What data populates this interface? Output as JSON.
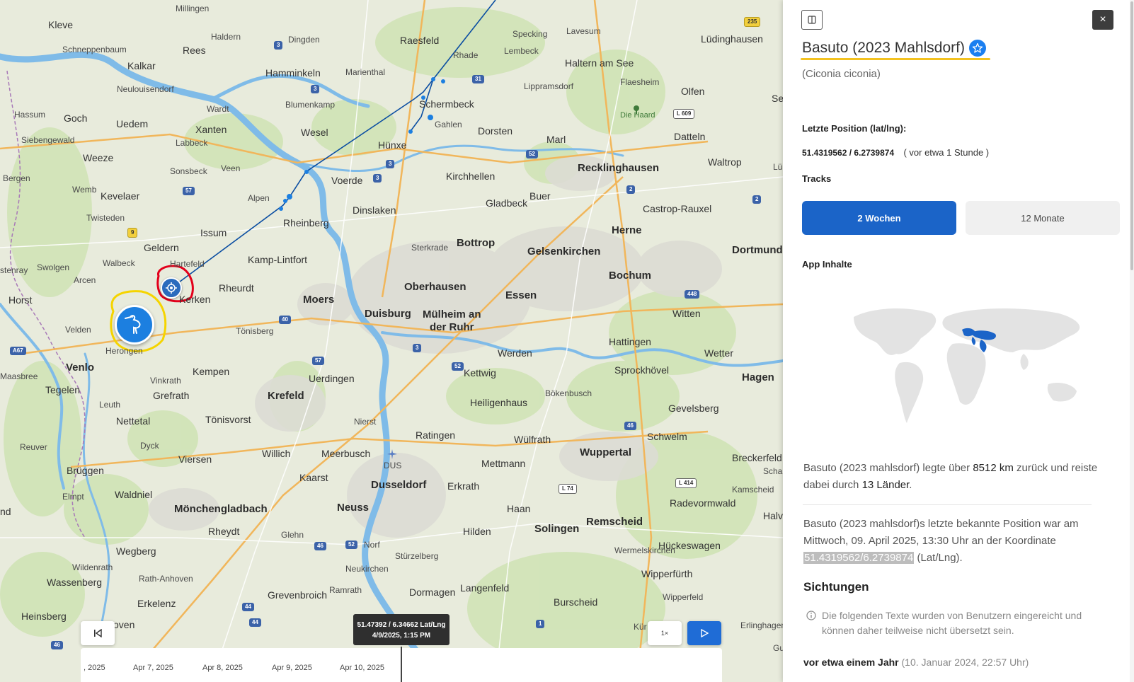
{
  "map": {
    "places": [
      {
        "id": "kleve",
        "label": "Kleve",
        "cls": "mid"
      },
      {
        "id": "millingen",
        "label": "Millingen",
        "cls": "small"
      },
      {
        "id": "schneppenbaum",
        "label": "Schneppenbaum",
        "cls": "small"
      },
      {
        "id": "haldern",
        "label": "Haldern",
        "cls": "small"
      },
      {
        "id": "rees",
        "label": "Rees",
        "cls": "mid"
      },
      {
        "id": "dingden",
        "label": "Dingden",
        "cls": "small"
      },
      {
        "id": "raesfeld",
        "label": "Raesfeld",
        "cls": "mid"
      },
      {
        "id": "specking",
        "label": "Specking",
        "cls": "small"
      },
      {
        "id": "lavesum",
        "label": "Lavesum",
        "cls": "small"
      },
      {
        "id": "luedinghausen",
        "label": "Lüdinghausen",
        "cls": "mid"
      },
      {
        "id": "kalkar",
        "label": "Kalkar",
        "cls": "mid"
      },
      {
        "id": "hamminkeln",
        "label": "Hamminkeln",
        "cls": "mid"
      },
      {
        "id": "marienthal",
        "label": "Marienthal",
        "cls": "small"
      },
      {
        "id": "rhade",
        "label": "Rhade",
        "cls": "small"
      },
      {
        "id": "lembeck",
        "label": "Lembeck",
        "cls": "small"
      },
      {
        "id": "halternamsee",
        "label": "Haltern am See",
        "cls": "mid"
      },
      {
        "id": "neulouisendorf",
        "label": "Neulouisendorf",
        "cls": "small"
      },
      {
        "id": "lippramsdorf",
        "label": "Lippramsdorf",
        "cls": "small"
      },
      {
        "id": "flaesheim",
        "label": "Flaesheim",
        "cls": "small"
      },
      {
        "id": "olfen",
        "label": "Olfen",
        "cls": "mid"
      },
      {
        "id": "hassum",
        "label": "Hassum",
        "cls": "small"
      },
      {
        "id": "goch",
        "label": "Goch",
        "cls": "mid"
      },
      {
        "id": "uedem",
        "label": "Uedem",
        "cls": "mid"
      },
      {
        "id": "blumenkamp",
        "label": "Blumenkamp",
        "cls": "small"
      },
      {
        "id": "schermbeck",
        "label": "Schermbeck",
        "cls": "mid"
      },
      {
        "id": "selm",
        "label": "Selm",
        "cls": "mid"
      },
      {
        "id": "wardt",
        "label": "Wardt",
        "cls": "small"
      },
      {
        "id": "dieharrd",
        "label": "Die Haard",
        "cls": "green"
      },
      {
        "id": "siebengewald",
        "label": "Siebengewald",
        "cls": "small"
      },
      {
        "id": "xanten",
        "label": "Xanten",
        "cls": "mid"
      },
      {
        "id": "wesel",
        "label": "Wesel",
        "cls": "mid"
      },
      {
        "id": "gahlen",
        "label": "Gahlen",
        "cls": "small"
      },
      {
        "id": "dorsten",
        "label": "Dorsten",
        "cls": "mid"
      },
      {
        "id": "datteln",
        "label": "Datteln",
        "cls": "mid"
      },
      {
        "id": "labbeck",
        "label": "Labbeck",
        "cls": "small"
      },
      {
        "id": "huenxe",
        "label": "Hünxe",
        "cls": "mid"
      },
      {
        "id": "marl",
        "label": "Marl",
        "cls": "mid"
      },
      {
        "id": "waltrop",
        "label": "Waltrop",
        "cls": "mid"
      },
      {
        "id": "weeze",
        "label": "Weeze",
        "cls": "mid"
      },
      {
        "id": "veen",
        "label": "Veen",
        "cls": "small"
      },
      {
        "id": "sonsbeck",
        "label": "Sonsbeck",
        "cls": "small"
      },
      {
        "id": "recklinghausen",
        "label": "Recklinghausen",
        "cls": "big"
      },
      {
        "id": "bergen",
        "label": "Bergen",
        "cls": "small"
      },
      {
        "id": "kirchhellen",
        "label": "Kirchhellen",
        "cls": "mid"
      },
      {
        "id": "voerde",
        "label": "Voerde",
        "cls": "mid"
      },
      {
        "id": "wemb",
        "label": "Wemb",
        "cls": "small"
      },
      {
        "id": "kevelaer",
        "label": "Kevelaer",
        "cls": "mid"
      },
      {
        "id": "alpen",
        "label": "Alpen",
        "cls": "small"
      },
      {
        "id": "buer",
        "label": "Buer",
        "cls": "mid"
      },
      {
        "id": "gladbeck",
        "label": "Gladbeck",
        "cls": "mid"
      },
      {
        "id": "castroprauxel",
        "label": "Castrop-Rauxel",
        "cls": "mid"
      },
      {
        "id": "dinslaken",
        "label": "Dinslaken",
        "cls": "mid"
      },
      {
        "id": "twisteden",
        "label": "Twisteden",
        "cls": "small"
      },
      {
        "id": "rheinberg",
        "label": "Rheinberg",
        "cls": "mid"
      },
      {
        "id": "issum",
        "label": "Issum",
        "cls": "mid"
      },
      {
        "id": "herne",
        "label": "Herne",
        "cls": "big"
      },
      {
        "id": "dortmund",
        "label": "Dortmund",
        "cls": "big"
      },
      {
        "id": "bottrop",
        "label": "Bottrop",
        "cls": "big"
      },
      {
        "id": "sterkrade",
        "label": "Sterkrade",
        "cls": "small"
      },
      {
        "id": "geldern",
        "label": "Geldern",
        "cls": "mid"
      },
      {
        "id": "gelsenkirchen",
        "label": "Gelsenkirchen",
        "cls": "big"
      },
      {
        "id": "kamplintfort",
        "label": "Kamp-Lintfort",
        "cls": "mid"
      },
      {
        "id": "walbeck",
        "label": "Walbeck",
        "cls": "small"
      },
      {
        "id": "swolgen",
        "label": "Swolgen",
        "cls": "small"
      },
      {
        "id": "hartefeld",
        "label": "Hartefeld",
        "cls": "small"
      },
      {
        "id": "bochum",
        "label": "Bochum",
        "cls": "big"
      },
      {
        "id": "astenray",
        "label": "stenray",
        "cls": "small"
      },
      {
        "id": "arcen",
        "label": "Arcen",
        "cls": "small"
      },
      {
        "id": "rheurdt",
        "label": "Rheurdt",
        "cls": "mid"
      },
      {
        "id": "oberhausen",
        "label": "Oberhausen",
        "cls": "big"
      },
      {
        "id": "essen",
        "label": "Essen",
        "cls": "big"
      },
      {
        "id": "moers",
        "label": "Moers",
        "cls": "big"
      },
      {
        "id": "horst",
        "label": "Horst",
        "cls": "mid"
      },
      {
        "id": "kerken",
        "label": "Kerken",
        "cls": "mid"
      },
      {
        "id": "duisburg",
        "label": "Duisburg",
        "cls": "big"
      },
      {
        "id": "muelheim",
        "label": "Mülheim an\nder Ruhr",
        "cls": "big"
      },
      {
        "id": "witten",
        "label": "Witten",
        "cls": "mid"
      },
      {
        "id": "velden",
        "label": "Velden",
        "cls": "small"
      },
      {
        "id": "toenisberg",
        "label": "Tönisberg",
        "cls": "small"
      },
      {
        "id": "hattingen",
        "label": "Hattingen",
        "cls": "mid"
      },
      {
        "id": "herongen",
        "label": "Herongen",
        "cls": "small"
      },
      {
        "id": "wetter",
        "label": "Wetter",
        "cls": "mid"
      },
      {
        "id": "werden",
        "label": "Werden",
        "cls": "mid"
      },
      {
        "id": "venlo",
        "label": "Venlo",
        "cls": "big"
      },
      {
        "id": "vinkrath",
        "label": "Vinkrath",
        "cls": "small"
      },
      {
        "id": "kempen",
        "label": "Kempen",
        "cls": "mid"
      },
      {
        "id": "sprockhoevel",
        "label": "Sprockhövel",
        "cls": "mid"
      },
      {
        "id": "maasbree",
        "label": "Maasbree",
        "cls": "small"
      },
      {
        "id": "kettwig",
        "label": "Kettwig",
        "cls": "mid"
      },
      {
        "id": "uerdingen",
        "label": "Uerdingen",
        "cls": "mid"
      },
      {
        "id": "hagen",
        "label": "Hagen",
        "cls": "big"
      },
      {
        "id": "tegelen",
        "label": "Tegelen",
        "cls": "mid"
      },
      {
        "id": "boekenbusch",
        "label": "Bökenbusch",
        "cls": "small"
      },
      {
        "id": "leuth",
        "label": "Leuth",
        "cls": "small"
      },
      {
        "id": "grefrath",
        "label": "Grefrath",
        "cls": "mid"
      },
      {
        "id": "krefeld",
        "label": "Krefeld",
        "cls": "big"
      },
      {
        "id": "heiligenhaus",
        "label": "Heiligenhaus",
        "cls": "mid"
      },
      {
        "id": "gevelsberg",
        "label": "Gevelsberg",
        "cls": "mid"
      },
      {
        "id": "nettetal",
        "label": "Nettetal",
        "cls": "mid"
      },
      {
        "id": "toenisvorst",
        "label": "Tönisvorst",
        "cls": "mid"
      },
      {
        "id": "nierst",
        "label": "Nierst",
        "cls": "small"
      },
      {
        "id": "ratingen",
        "label": "Ratingen",
        "cls": "mid"
      },
      {
        "id": "reuver",
        "label": "Reuver",
        "cls": "small"
      },
      {
        "id": "dyck",
        "label": "Dyck",
        "cls": "small"
      },
      {
        "id": "wuelfrath",
        "label": "Wülfrath",
        "cls": "mid"
      },
      {
        "id": "schwelm",
        "label": "Schwelm",
        "cls": "mid"
      },
      {
        "id": "willich",
        "label": "Willich",
        "cls": "mid"
      },
      {
        "id": "meerbusch",
        "label": "Meerbusch",
        "cls": "mid"
      },
      {
        "id": "wuppertal",
        "label": "Wuppertal",
        "cls": "big"
      },
      {
        "id": "breckerfeld",
        "label": "Breckerfeld",
        "cls": "mid"
      },
      {
        "id": "viersen",
        "label": "Viersen",
        "cls": "mid"
      },
      {
        "id": "mettmann",
        "label": "Mettmann",
        "cls": "mid"
      },
      {
        "id": "schal",
        "label": "Schal",
        "cls": "small"
      },
      {
        "id": "brueggen",
        "label": "Brüggen",
        "cls": "mid"
      },
      {
        "id": "kaarst",
        "label": "Kaarst",
        "cls": "mid"
      },
      {
        "id": "duesseldorf",
        "label": "Dusseldorf",
        "cls": "big"
      },
      {
        "id": "erkrath",
        "label": "Erkrath",
        "cls": "mid"
      },
      {
        "id": "kamsche",
        "label": "Kamscheid",
        "cls": "small"
      },
      {
        "id": "waldniel",
        "label": "Waldniel",
        "cls": "mid"
      },
      {
        "id": "elmpt",
        "label": "Elmpt",
        "cls": "small"
      },
      {
        "id": "radevormwald",
        "label": "Radevormwald",
        "cls": "mid"
      },
      {
        "id": "neuss",
        "label": "Neuss",
        "cls": "big"
      },
      {
        "id": "haan",
        "label": "Haan",
        "cls": "mid"
      },
      {
        "id": "moenchengladbach",
        "label": "Mönchengladbach",
        "cls": "big"
      },
      {
        "id": "solingen",
        "label": "Solingen",
        "cls": "big"
      },
      {
        "id": "halver",
        "label": "Halver",
        "cls": "mid"
      },
      {
        "id": "remscheid",
        "label": "Remscheid",
        "cls": "big"
      },
      {
        "id": "hilden",
        "label": "Hilden",
        "cls": "mid"
      },
      {
        "id": "rheydt",
        "label": "Rheydt",
        "cls": "mid"
      },
      {
        "id": "glehn",
        "label": "Glehn",
        "cls": "small"
      },
      {
        "id": "wegberg",
        "label": "Wegberg",
        "cls": "mid"
      },
      {
        "id": "norf",
        "label": "Norf",
        "cls": "small"
      },
      {
        "id": "hueckeswagen",
        "label": "Hückeswagen",
        "cls": "mid"
      },
      {
        "id": "stuerzelberg",
        "label": "Stürzelberg",
        "cls": "small"
      },
      {
        "id": "wildenrath",
        "label": "Wildenrath",
        "cls": "small"
      },
      {
        "id": "wermelskirchen",
        "label": "Wermelskirchen",
        "cls": "small"
      },
      {
        "id": "wipperfuerth",
        "label": "Wipperfürth",
        "cls": "mid"
      },
      {
        "id": "wassenberg",
        "label": "Wassenberg",
        "cls": "mid"
      },
      {
        "id": "rathkeloelen",
        "label": "Rath-Anhoven",
        "cls": "small"
      },
      {
        "id": "langenfeld",
        "label": "Langenfeld",
        "cls": "mid"
      },
      {
        "id": "wipperfeld",
        "label": "Wipperfeld",
        "cls": "small"
      },
      {
        "id": "neukirchen",
        "label": "Neukirchen",
        "cls": "small"
      },
      {
        "id": "ramrath",
        "label": "Ramrath",
        "cls": "small"
      },
      {
        "id": "grevenbroich",
        "label": "Grevenbroich",
        "cls": "mid"
      },
      {
        "id": "dormagen",
        "label": "Dormagen",
        "cls": "mid"
      },
      {
        "id": "erkelenz",
        "label": "Erkelenz",
        "cls": "mid"
      },
      {
        "id": "burscheid",
        "label": "Burscheid",
        "cls": "mid"
      },
      {
        "id": "heinsberg",
        "label": "Heinsberg",
        "cls": "mid"
      },
      {
        "id": "hoven",
        "label": "oven",
        "cls": "mid"
      },
      {
        "id": "erlinghagen",
        "label": "Erlinghagen",
        "cls": "small"
      },
      {
        "id": "kuer",
        "label": "Kür",
        "cls": "small"
      },
      {
        "id": "gu",
        "label": "Gu",
        "cls": "small"
      },
      {
        "id": "lue",
        "label": "Lü",
        "cls": "small"
      },
      {
        "id": "nd",
        "label": "nd",
        "cls": "mid"
      },
      {
        "id": "dus",
        "label": "DUS",
        "cls": "small"
      }
    ],
    "shields": [
      {
        "id": "s235",
        "label": "235",
        "cls": "yellow"
      },
      {
        "id": "s3a",
        "label": "3",
        "cls": "blue"
      },
      {
        "id": "s3b",
        "label": "3",
        "cls": "blue"
      },
      {
        "id": "s31",
        "label": "31",
        "cls": "blue"
      },
      {
        "id": "sL609",
        "label": "L 609",
        "cls": "white"
      },
      {
        "id": "s52a",
        "label": "52",
        "cls": "blue"
      },
      {
        "id": "s3c",
        "label": "3",
        "cls": "blue"
      },
      {
        "id": "s3d",
        "label": "3",
        "cls": "blue"
      },
      {
        "id": "s2a",
        "label": "2",
        "cls": "blue"
      },
      {
        "id": "s2b",
        "label": "2",
        "cls": "blue"
      },
      {
        "id": "s57a",
        "label": "57",
        "cls": "blue"
      },
      {
        "id": "s9",
        "label": "9",
        "cls": "yellow"
      },
      {
        "id": "s448",
        "label": "448",
        "cls": "blue"
      },
      {
        "id": "s40",
        "label": "40",
        "cls": "blue"
      },
      {
        "id": "sA67",
        "label": "A67",
        "cls": "blue"
      },
      {
        "id": "s57b",
        "label": "57",
        "cls": "blue"
      },
      {
        "id": "s3e",
        "label": "3",
        "cls": "blue"
      },
      {
        "id": "s52b",
        "label": "52",
        "cls": "blue"
      },
      {
        "id": "s46a",
        "label": "46",
        "cls": "blue"
      },
      {
        "id": "sL74",
        "label": "L 74",
        "cls": "white"
      },
      {
        "id": "sL414",
        "label": "L 414",
        "cls": "white"
      },
      {
        "id": "s52c",
        "label": "52",
        "cls": "blue"
      },
      {
        "id": "s46b",
        "label": "46",
        "cls": "blue"
      },
      {
        "id": "s44a",
        "label": "44",
        "cls": "blue"
      },
      {
        "id": "s44b",
        "label": "44",
        "cls": "blue"
      },
      {
        "id": "s1",
        "label": "1",
        "cls": "blue"
      },
      {
        "id": "s46c",
        "label": "46",
        "cls": "blue"
      }
    ],
    "tooltip": {
      "coords": "51.47392 / 6.34662 Lat/Lng",
      "datetime": "4/9/2025, 1:15 PM"
    },
    "timeline": {
      "ticks": [
        ", 2025",
        "Apr 7, 2025",
        "Apr 8, 2025",
        "Apr 9, 2025",
        "Apr 10, 2025"
      ]
    },
    "controls": {
      "rewind_icon": "skip-back-icon",
      "speed_label": "1×",
      "play_icon": "play-icon"
    },
    "colors": {
      "track": "#0b4ea2",
      "marker": "#1c7fe0",
      "highlight_yellow": "#f5d400",
      "highlight_red": "#e3001b",
      "river": "#6fb4e8"
    }
  },
  "panel": {
    "sidebar_toggle_icon": "sidebar-toggle-icon",
    "close_label": "×",
    "name": "Basuto (2023 Mahlsdorf)",
    "star_icon": "star-badge-icon",
    "species": "(Ciconia ciconia)",
    "last_position_label": "Letzte Position (lat/lng):",
    "last_position_coords": "51.4319562 / 6.2739874",
    "last_position_ago": "( vor etwa 1 Stunde )",
    "tracks_label": "Tracks",
    "tracks": [
      {
        "label": "2 Wochen",
        "active": true
      },
      {
        "label": "12 Monate",
        "active": false
      }
    ],
    "app_content_label": "App Inhalte",
    "summary": {
      "p1": "Basuto (2023 mahlsdorf) legte über ",
      "km": "8512 km",
      "p2": " zurück und reiste dabei durch ",
      "countries": "13 Länder",
      "p3": "."
    },
    "last_known": {
      "p1": "Basuto (2023 mahlsdorf)s letzte bekannte Position war am Mittwoch, 09. April 2025, 13:30 Uhr an der Koordinate ",
      "coords": "51.4319562/6.2739874",
      "p2": " (Lat/Lng)."
    },
    "sightings_title": "Sichtungen",
    "sightings_info": "Die folgenden Texte wurden von Benutzern eingereicht und können daher teilweise nicht übersetzt sein.",
    "sighting_when": "vor etwa einem Jahr",
    "sighting_date": "(10. Januar 2024, 22:57 Uhr)"
  }
}
